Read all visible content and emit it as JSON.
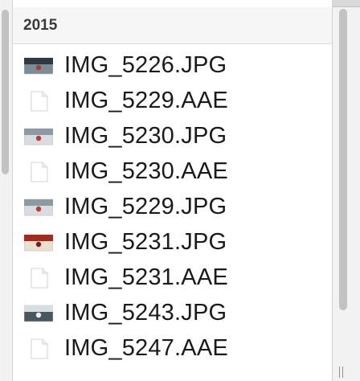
{
  "column": {
    "title": "2015"
  },
  "files": [
    {
      "name": "IMG_5226.JPG",
      "kind": "photo",
      "thumb_colors": [
        "#2c3a44",
        "#7a8c96",
        "#b03a2e"
      ]
    },
    {
      "name": "IMG_5229.AAE",
      "kind": "document"
    },
    {
      "name": "IMG_5230.JPG",
      "kind": "photo",
      "thumb_colors": [
        "#8b9aa4",
        "#d7dde0",
        "#c0392b"
      ]
    },
    {
      "name": "IMG_5230.AAE",
      "kind": "document"
    },
    {
      "name": "IMG_5229.JPG",
      "kind": "photo",
      "thumb_colors": [
        "#8b9aa4",
        "#d7dde0",
        "#c0392b"
      ]
    },
    {
      "name": "IMG_5231.JPG",
      "kind": "photo",
      "thumb_colors": [
        "#a52a1e",
        "#e8e0d0",
        "#7a1f15"
      ]
    },
    {
      "name": "IMG_5231.AAE",
      "kind": "document"
    },
    {
      "name": "IMG_5243.JPG",
      "kind": "photo",
      "thumb_colors": [
        "#d8dde2",
        "#4a5660",
        "#f2f4f6"
      ]
    },
    {
      "name": "IMG_5247.AAE",
      "kind": "document"
    }
  ]
}
